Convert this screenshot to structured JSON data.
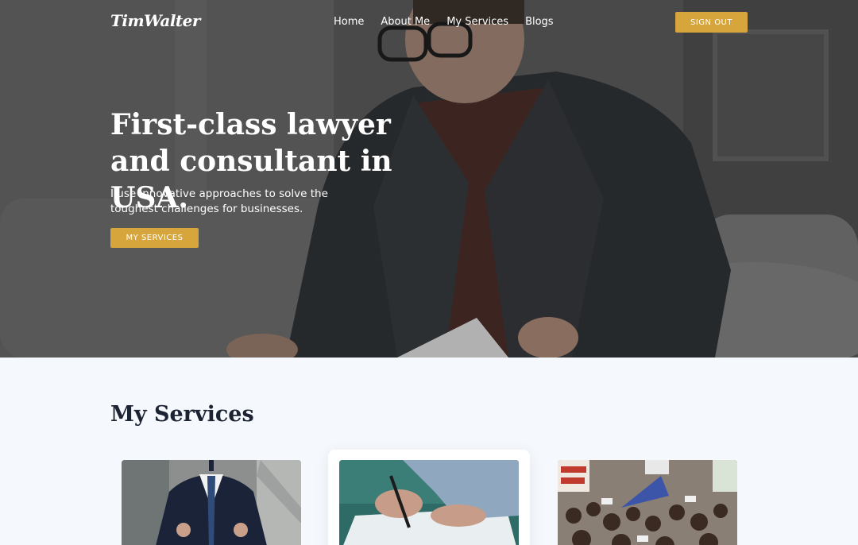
{
  "brand": {
    "logo": "TimWalter"
  },
  "nav": {
    "items": [
      {
        "label": "Home"
      },
      {
        "label": "About Me"
      },
      {
        "label": "My Services"
      },
      {
        "label": "Blogs"
      }
    ],
    "signout_label": "SIGN OUT"
  },
  "hero": {
    "title": "First-class lawyer and consultant in USA.",
    "subtitle": "I use innovative approaches to solve the toughest challenges for businesses.",
    "cta_label": "MY SERVICES"
  },
  "services": {
    "title": "My Services",
    "cards": [
      {
        "image": "businessman-suit-photo"
      },
      {
        "image": "signing-document-photo"
      },
      {
        "image": "protest-crowd-photo"
      }
    ]
  },
  "colors": {
    "accent": "#d6a53b",
    "heading": "#1c2333",
    "section_bg": "#f5f8fc"
  }
}
